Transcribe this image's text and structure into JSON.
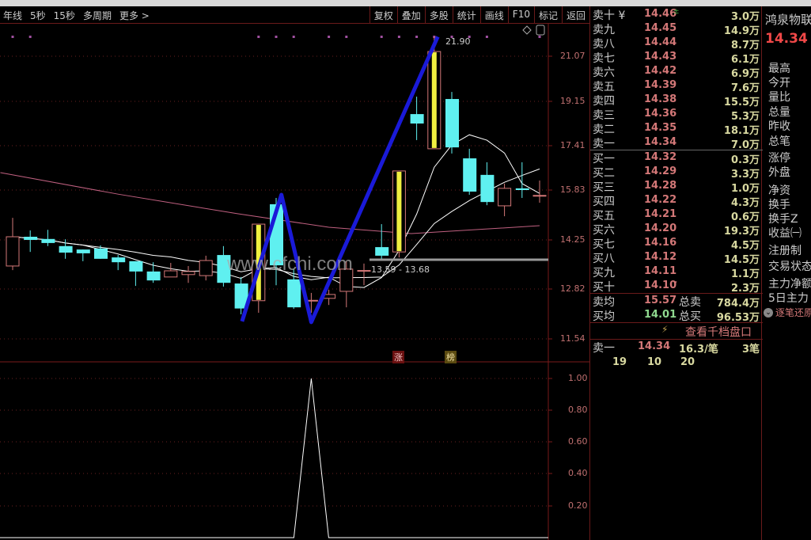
{
  "toolbar": {
    "left": [
      "年线",
      "5秒",
      "15秒",
      "多周期",
      "更多 >"
    ],
    "right": [
      "复权",
      "叠加",
      "多股",
      "统计",
      "画线",
      "F10",
      "标记",
      "返回"
    ]
  },
  "chart_data": {
    "type": "candlestick",
    "yticks": [
      21.07,
      19.15,
      17.41,
      15.83,
      14.25,
      12.82,
      11.54
    ],
    "candles": [
      {
        "o": 13.49,
        "h": 14.95,
        "l": 13.37,
        "c": 14.35
      },
      {
        "o": 14.35,
        "h": 14.55,
        "l": 13.9,
        "c": 14.25
      },
      {
        "o": 14.28,
        "h": 14.57,
        "l": 14.07,
        "c": 14.16
      },
      {
        "o": 14.07,
        "h": 14.27,
        "l": 13.7,
        "c": 13.88
      },
      {
        "o": 13.97,
        "h": 13.97,
        "l": 13.63,
        "c": 13.86
      },
      {
        "o": 14.0,
        "h": 14.09,
        "l": 13.7,
        "c": 13.7
      },
      {
        "o": 13.74,
        "h": 13.81,
        "l": 13.37,
        "c": 13.6
      },
      {
        "o": 13.63,
        "h": 13.63,
        "l": 12.91,
        "c": 13.33
      },
      {
        "o": 13.33,
        "h": 13.6,
        "l": 13.0,
        "c": 13.07
      },
      {
        "o": 13.17,
        "h": 13.58,
        "l": 13.17,
        "c": 13.35
      },
      {
        "o": 13.24,
        "h": 13.49,
        "l": 13.0,
        "c": 13.33
      },
      {
        "o": 13.21,
        "h": 13.79,
        "l": 13.07,
        "c": 13.65
      },
      {
        "o": 13.81,
        "h": 14.07,
        "l": 12.89,
        "c": 13.0
      },
      {
        "o": 12.98,
        "h": 13.17,
        "l": 12.17,
        "c": 12.32
      },
      {
        "o": 12.52,
        "h": 14.75,
        "l": 12.21,
        "c": 14.75,
        "limit": true
      },
      {
        "o": 15.38,
        "h": 15.58,
        "l": 12.93,
        "c": 13.51
      },
      {
        "o": 13.1,
        "h": 13.4,
        "l": 12.31,
        "c": 12.35
      },
      {
        "o": 12.52,
        "h": 12.72,
        "l": 12.21,
        "c": 12.53
      },
      {
        "o": 12.58,
        "h": 12.8,
        "l": 12.41,
        "c": 12.68
      },
      {
        "o": 12.76,
        "h": 13.63,
        "l": 12.35,
        "c": 13.4
      },
      {
        "o": 13.35,
        "h": 13.56,
        "l": 12.93,
        "c": 13.36
      },
      {
        "o": 14.04,
        "h": 14.75,
        "l": 13.7,
        "c": 13.79
      },
      {
        "o": 13.9,
        "h": 16.51,
        "l": 13.74,
        "c": 16.51,
        "limit": true
      },
      {
        "o": 18.65,
        "h": 19.35,
        "l": 17.63,
        "c": 18.28
      },
      {
        "o": 17.3,
        "h": 21.9,
        "l": 17.3,
        "c": 21.27,
        "limit": true
      },
      {
        "o": 19.25,
        "h": 19.55,
        "l": 17.13,
        "c": 17.35
      },
      {
        "o": 16.96,
        "h": 17.3,
        "l": 15.68,
        "c": 15.78
      },
      {
        "o": 16.37,
        "h": 16.82,
        "l": 15.35,
        "c": 15.45
      },
      {
        "o": 15.33,
        "h": 16.06,
        "l": 15.0,
        "c": 15.89
      },
      {
        "o": 15.89,
        "h": 16.82,
        "l": 15.58,
        "c": 15.83
      },
      {
        "o": 15.65,
        "h": 16.17,
        "l": 15.43,
        "c": 15.66
      }
    ],
    "long_ma": [
      {
        "i": -0.7,
        "v": 16.45
      },
      {
        "i": 6,
        "v": 15.7
      },
      {
        "i": 12.8,
        "v": 15.08
      },
      {
        "i": 18,
        "v": 14.65
      },
      {
        "i": 22.7,
        "v": 14.45
      },
      {
        "i": 30,
        "v": 14.7
      }
    ],
    "zigzag": [
      {
        "i": 13.06,
        "v": 11.99
      },
      {
        "i": 15.3,
        "v": 15.68
      },
      {
        "i": 17.0,
        "v": 11.97
      },
      {
        "i": 24.2,
        "v": 21.9
      }
    ],
    "marker_dots": [
      0,
      1,
      14,
      15,
      16,
      18,
      19,
      21,
      22,
      23,
      24,
      25,
      26,
      27,
      30
    ],
    "support_line": 13.68,
    "range_label": "13.59 - 13.68",
    "peak_label": "21.90",
    "indicator": {
      "yticks": [
        1.0,
        0.8,
        0.6,
        0.4,
        0.2
      ],
      "values_nonzero": [
        {
          "i": 17,
          "v": 1.0
        }
      ]
    },
    "tags": [
      "涨",
      "榜"
    ],
    "colors": {
      "up": "#d47878",
      "down": "#5ff0f0",
      "limit": "#f0f040",
      "zigzag": "#1a1ad8",
      "ma": "#ffffff",
      "long_ma": "#c06080"
    }
  },
  "watermark": "www.cfchi.com",
  "quote": {
    "sell": [
      [
        "卖十 ¥",
        "14.46",
        "3.0万"
      ],
      [
        "卖九",
        "14.45",
        "14.9万"
      ],
      [
        "卖八",
        "14.44",
        "8.7万"
      ],
      [
        "卖七",
        "14.43",
        "6.1万"
      ],
      [
        "卖六",
        "14.42",
        "6.9万"
      ],
      [
        "卖五",
        "14.39",
        "7.6万"
      ],
      [
        "卖四",
        "14.38",
        "15.5万"
      ],
      [
        "卖三",
        "14.36",
        "5.3万"
      ],
      [
        "卖二",
        "14.35",
        "18.1万"
      ],
      [
        "卖一",
        "14.34",
        "7.0万"
      ]
    ],
    "buy": [
      [
        "买一",
        "14.32",
        "0.3万"
      ],
      [
        "买二",
        "14.29",
        "3.3万"
      ],
      [
        "买三",
        "14.28",
        "1.0万"
      ],
      [
        "买四",
        "14.22",
        "4.3万"
      ],
      [
        "买五",
        "14.21",
        "0.6万"
      ],
      [
        "买六",
        "14.20",
        "19.3万"
      ],
      [
        "买七",
        "14.16",
        "4.5万"
      ],
      [
        "买八",
        "14.12",
        "14.5万"
      ],
      [
        "买九",
        "14.11",
        "1.1万"
      ],
      [
        "买十",
        "14.10",
        "2.3万"
      ]
    ],
    "sell_avg_label": "卖均",
    "sell_avg": "15.57",
    "total_sell_label": "总卖",
    "total_sell": "784.4万",
    "buy_avg_label": "买均",
    "buy_avg": "14.01",
    "total_buy_label": "总买",
    "total_buy": "96.53万",
    "depth_link": "查看千档盘口",
    "tick_label": "卖一",
    "tick_price": "14.34",
    "tick_per": "16.3/笔",
    "tick_count": "3笔",
    "tick_lots": [
      "19",
      "10",
      "20"
    ]
  },
  "info": {
    "name": "鸿泉物联",
    "price": "14.34",
    "labels": [
      "最高",
      "今开",
      "量比",
      "总量",
      "昨收",
      "总笔",
      "涨停",
      "外盘",
      "净资",
      "换手",
      "换手Z",
      "收益㈠",
      "注册制",
      "交易状态",
      "主力净额",
      "5日主力"
    ],
    "replay": "逐笔还原"
  }
}
